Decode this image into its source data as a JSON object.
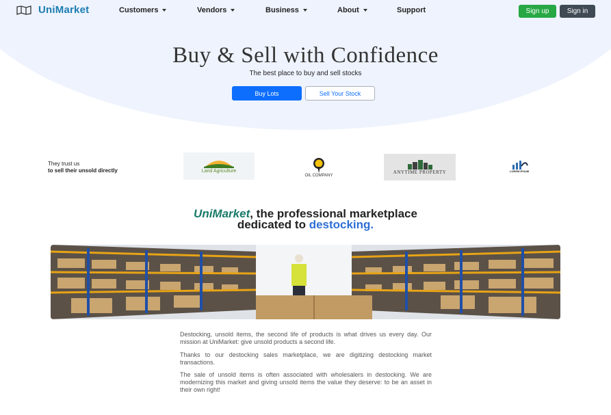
{
  "nav": {
    "brand": "UniMarket",
    "items": [
      {
        "label": "Customers",
        "dropdown": true
      },
      {
        "label": "Vendors",
        "dropdown": true
      },
      {
        "label": "Business",
        "dropdown": true
      },
      {
        "label": "About",
        "dropdown": true
      },
      {
        "label": "Support",
        "dropdown": false
      }
    ],
    "signup": "Sign up",
    "signin": "Sign in"
  },
  "hero": {
    "title": "Buy & Sell with Confidence",
    "subtitle": "The best place to buy and sell stocks",
    "buy_button": "Buy Lots",
    "sell_button": "Sell Your Stock"
  },
  "trust": {
    "line1": "They trust us",
    "line2": "to sell their unsold directly",
    "partners": [
      {
        "label": "Land Agriculture"
      },
      {
        "label": "OIL COMPANY"
      },
      {
        "label": "ANYTIME PROPERTY"
      },
      {
        "label": "LOREM IPSUM"
      }
    ]
  },
  "intro": {
    "brand": "UniMarket",
    "rest": ", the professional marketplace",
    "line2_prefix": "dedicated to ",
    "highlight": "destocking."
  },
  "body": {
    "p1": "Destocking, unsold items, the second life of products is what drives us every day. Our mission at UniMarket: give unsold products a second life.",
    "p2": "Thanks to our destocking sales marketplace, we are digitizing destocking market transactions.",
    "p3": "The sale of unsold items is often associated with wholesalers in destocking. We are modernizing this market and giving unsold items the value they deserve: to be an asset in their own right!"
  },
  "colors": {
    "brand": "#1c7cb0",
    "primary": "#0d6efd",
    "success": "#27a845",
    "dark": "#3f4a55",
    "hero_bg": "#eef3fd"
  },
  "icons": {
    "brand": "map-icon",
    "dropdown": "chevron-down-icon"
  }
}
